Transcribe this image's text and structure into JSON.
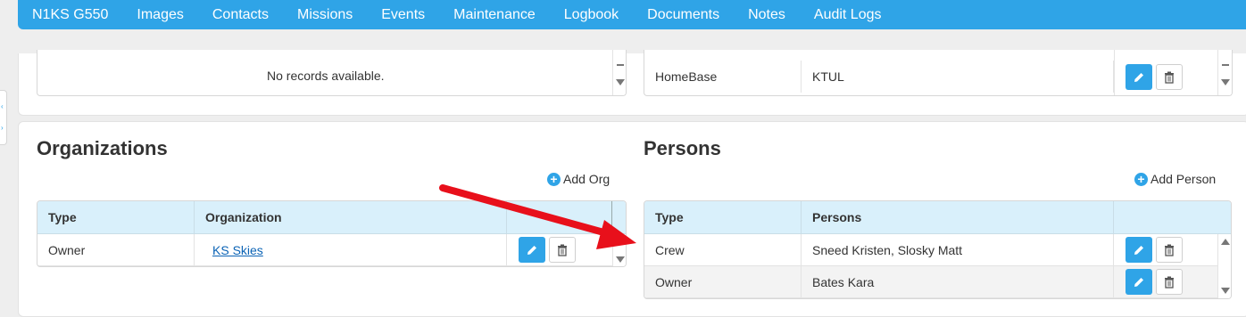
{
  "nav": {
    "brand": "N1KS G550",
    "items": [
      "Images",
      "Contacts",
      "Missions",
      "Events",
      "Maintenance",
      "Logbook",
      "Documents",
      "Notes",
      "Audit Logs"
    ]
  },
  "top_section": {
    "left_grid": {
      "empty_message": "No records available."
    },
    "right_grid": {
      "row": {
        "label": "HomeBase",
        "value": "KTUL"
      }
    }
  },
  "organizations": {
    "title": "Organizations",
    "add_label": "Add Org",
    "columns": [
      "Type",
      "Organization"
    ],
    "rows": [
      {
        "type": "Owner",
        "organization": "KS Skies"
      }
    ]
  },
  "persons": {
    "title": "Persons",
    "add_label": "Add Person",
    "columns": [
      "Type",
      "Persons"
    ],
    "rows": [
      {
        "type": "Crew",
        "persons": "Sneed Kristen, Slosky Matt"
      },
      {
        "type": "Owner",
        "persons": "Bates Kara"
      }
    ]
  },
  "colors": {
    "accent": "#2fa4e7",
    "header_bg": "#d9f0fb",
    "annotation_arrow": "#e8101b"
  },
  "icons": {
    "edit": "pencil-icon",
    "delete": "trash-icon",
    "add": "plus-circle-icon"
  }
}
